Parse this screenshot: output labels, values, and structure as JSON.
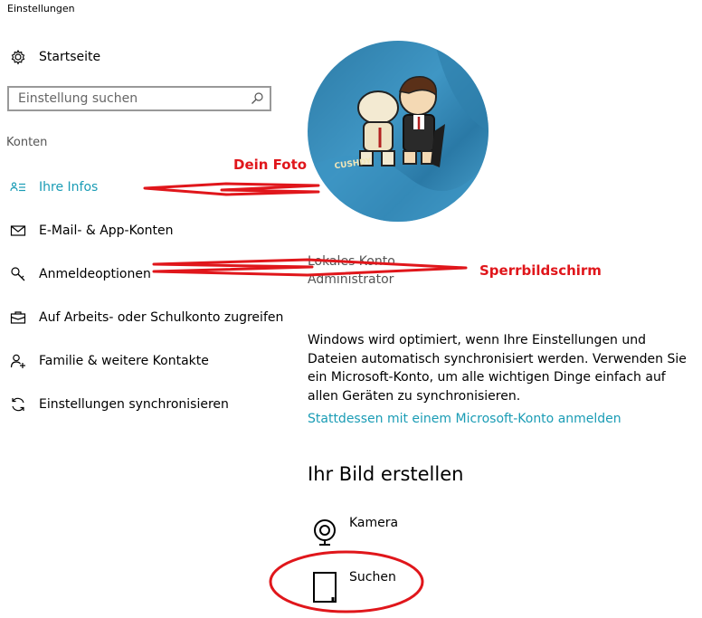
{
  "window": {
    "title": "Einstellungen"
  },
  "sidebar": {
    "home_label": "Startseite",
    "search_placeholder": "Einstellung suchen",
    "section_title": "Konten",
    "items": [
      {
        "label": "Ihre Infos",
        "icon": "person-list-icon",
        "selected": true
      },
      {
        "label": "E-Mail- & App-Konten",
        "icon": "mail-icon"
      },
      {
        "label": "Anmeldeoptionen",
        "icon": "key-icon"
      },
      {
        "label": "Auf Arbeits- oder Schulkonto zugreifen",
        "icon": "briefcase-icon"
      },
      {
        "label": "Familie & weitere Kontakte",
        "icon": "person-add-icon"
      },
      {
        "label": "Einstellungen synchronisieren",
        "icon": "sync-icon"
      }
    ]
  },
  "main": {
    "account_type": "Lokales Konto",
    "account_role": "Administrator",
    "sync_info": "Windows wird optimiert, wenn Ihre Einstellungen und Dateien automatisch synchronisiert werden. Verwenden Sie ein Microsoft-Konto, um alle wichtigen Dinge einfach auf allen Geräten zu synchronisieren.",
    "ms_account_link": "Stattdessen mit einem Microsoft-Konto anmelden",
    "create_picture_heading": "Ihr Bild erstellen",
    "options": [
      {
        "label": "Kamera",
        "icon": "camera-icon"
      },
      {
        "label": "Suchen",
        "icon": "browse-file-icon"
      }
    ],
    "avatar_sticker_text": "CUSHDY"
  },
  "annotations": {
    "photo_label": "Dein Foto",
    "lockscreen_label": "Sperrbildschirm",
    "color": "#e0161b"
  },
  "colors": {
    "accent": "#1a9cb5",
    "annotation_red": "#e0161b"
  }
}
